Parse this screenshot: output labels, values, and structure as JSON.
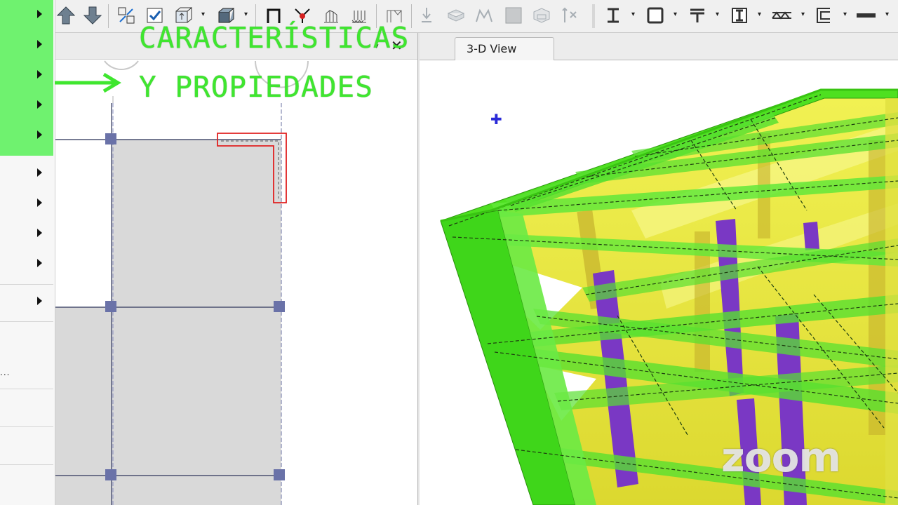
{
  "overlay": {
    "line1": "CARACTERÍSTICAS",
    "line2": "Y PROPIEDADES"
  },
  "view_tab": {
    "label": "3-D View"
  },
  "watermark": {
    "text": "zoom"
  },
  "sidebar": {
    "dots": "...",
    "items_count_expanded": 5
  },
  "toolbar": {
    "icons": [
      "move-up-icon",
      "move-down-icon",
      "select-icon",
      "checkbox-icon",
      "snap-icon",
      "object-icon",
      "frame-icon",
      "release-icon",
      "load-icon",
      "load-distributed-icon",
      "wall-icon",
      "point-load-icon",
      "slab-icon",
      "hinge-icon",
      "area-icon",
      "wall-opening-icon",
      "assign-icon",
      "section-i-icon",
      "section-box-icon",
      "section-t-icon",
      "section-i2-icon",
      "truss-icon",
      "section-c-icon",
      "section-plate-icon"
    ]
  },
  "colors": {
    "overlay_green": "#3fe62f",
    "sidebar_green": "#6ff26f",
    "model_green": "#4ee020",
    "slab_yellow": "#e8ea22",
    "column_purple": "#7a38c4",
    "plan_gray": "#d9d9d9",
    "selection_red": "#e02020",
    "cursor_blue": "#2a2ad8"
  }
}
